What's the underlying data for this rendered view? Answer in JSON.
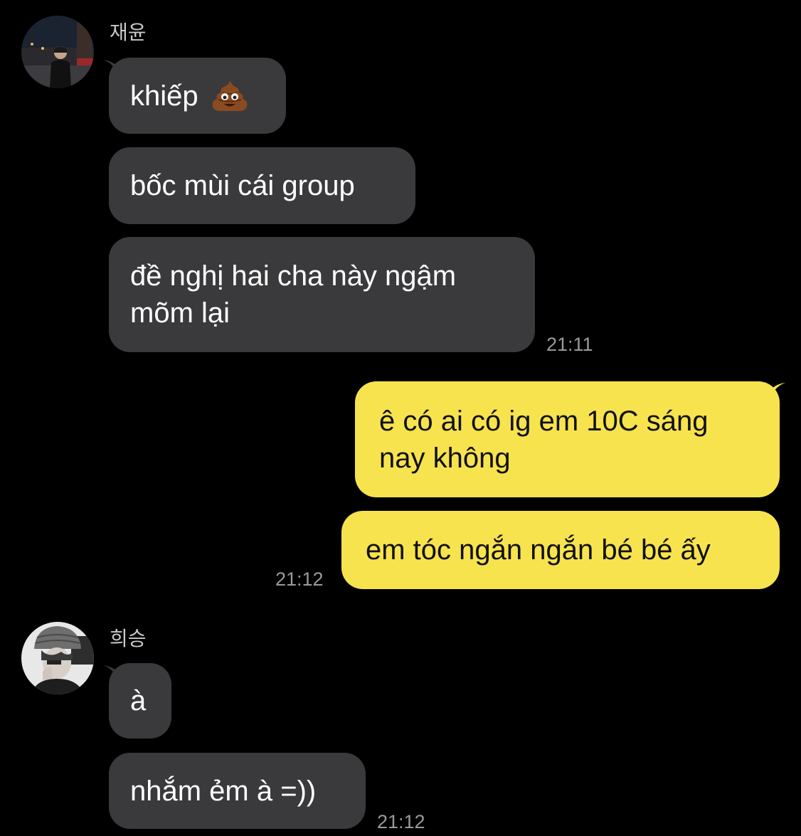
{
  "conversation": {
    "group1": {
      "sender": "재윤",
      "avatar_icon": "profile-photo-night-city",
      "messages": [
        {
          "text": "khiếp",
          "emoji": "pile-of-poo-icon"
        },
        {
          "text": "bốc mùi cái group"
        },
        {
          "text": "đề nghị hai cha này ngậm\nmõm lại"
        }
      ],
      "time": "21:11"
    },
    "my_group": {
      "messages": [
        {
          "text": "ê có ai có ig em 10C sáng\nnay không"
        },
        {
          "text": "em tóc ngắn ngắn bé bé ấy"
        }
      ],
      "time": "21:12"
    },
    "group2": {
      "sender": "희승",
      "avatar_icon": "profile-photo-beanie",
      "messages": [
        {
          "text": "à"
        },
        {
          "text": "nhắm ẻm à =))"
        }
      ],
      "time": "21:12"
    }
  },
  "colors": {
    "background": "#000000",
    "incoming_bubble": "#3a3a3c",
    "outgoing_bubble": "#f7e34e",
    "timestamp": "#9a9a9a"
  }
}
